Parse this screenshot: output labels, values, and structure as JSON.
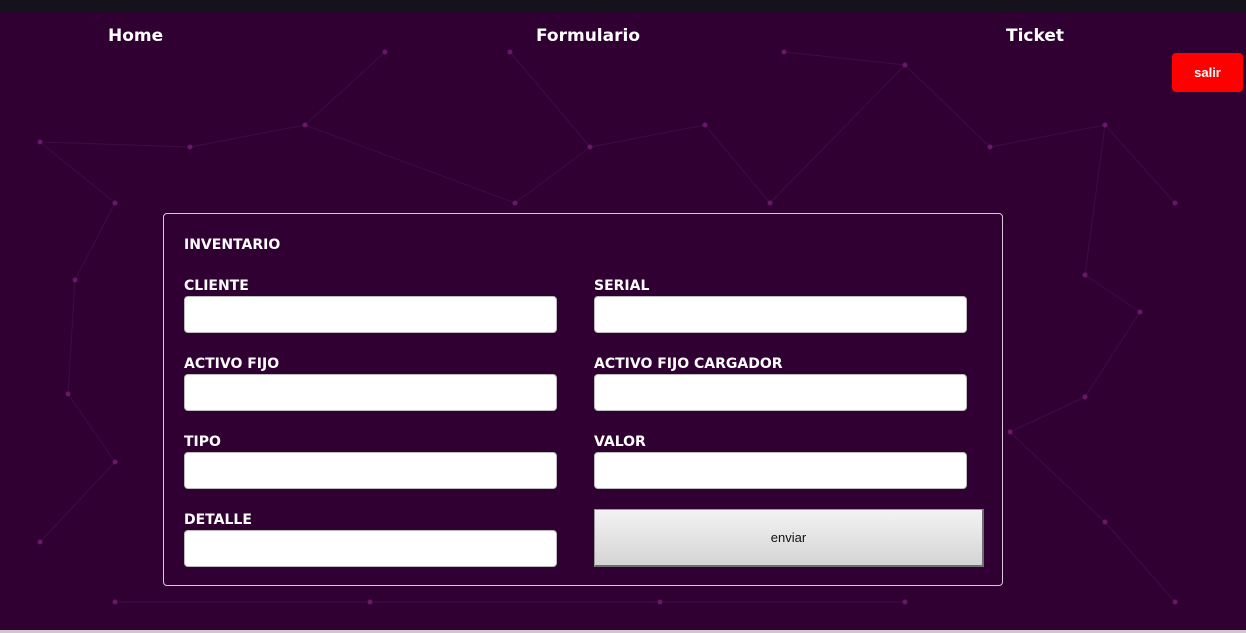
{
  "nav": {
    "home_label": "Home",
    "formulario_label": "Formulario",
    "ticket_label": "Ticket"
  },
  "logout": {
    "label": "salir",
    "color": "#ff0000"
  },
  "form": {
    "title": "INVENTARIO",
    "fields": {
      "cliente": {
        "label": "CLIENTE",
        "value": ""
      },
      "serial": {
        "label": "SERIAL",
        "value": ""
      },
      "activo_fijo": {
        "label": "ACTIVO FIJO",
        "value": ""
      },
      "activo_fijo_cargador": {
        "label": "ACTIVO FIJO CARGADOR",
        "value": ""
      },
      "tipo": {
        "label": "TIPO",
        "value": ""
      },
      "valor": {
        "label": "VALOR",
        "value": ""
      },
      "detalle": {
        "label": "DETALLE",
        "value": ""
      }
    },
    "submit_label": "enviar"
  },
  "theme": {
    "background": "#310033",
    "network_node_color": "#7a1f78"
  }
}
